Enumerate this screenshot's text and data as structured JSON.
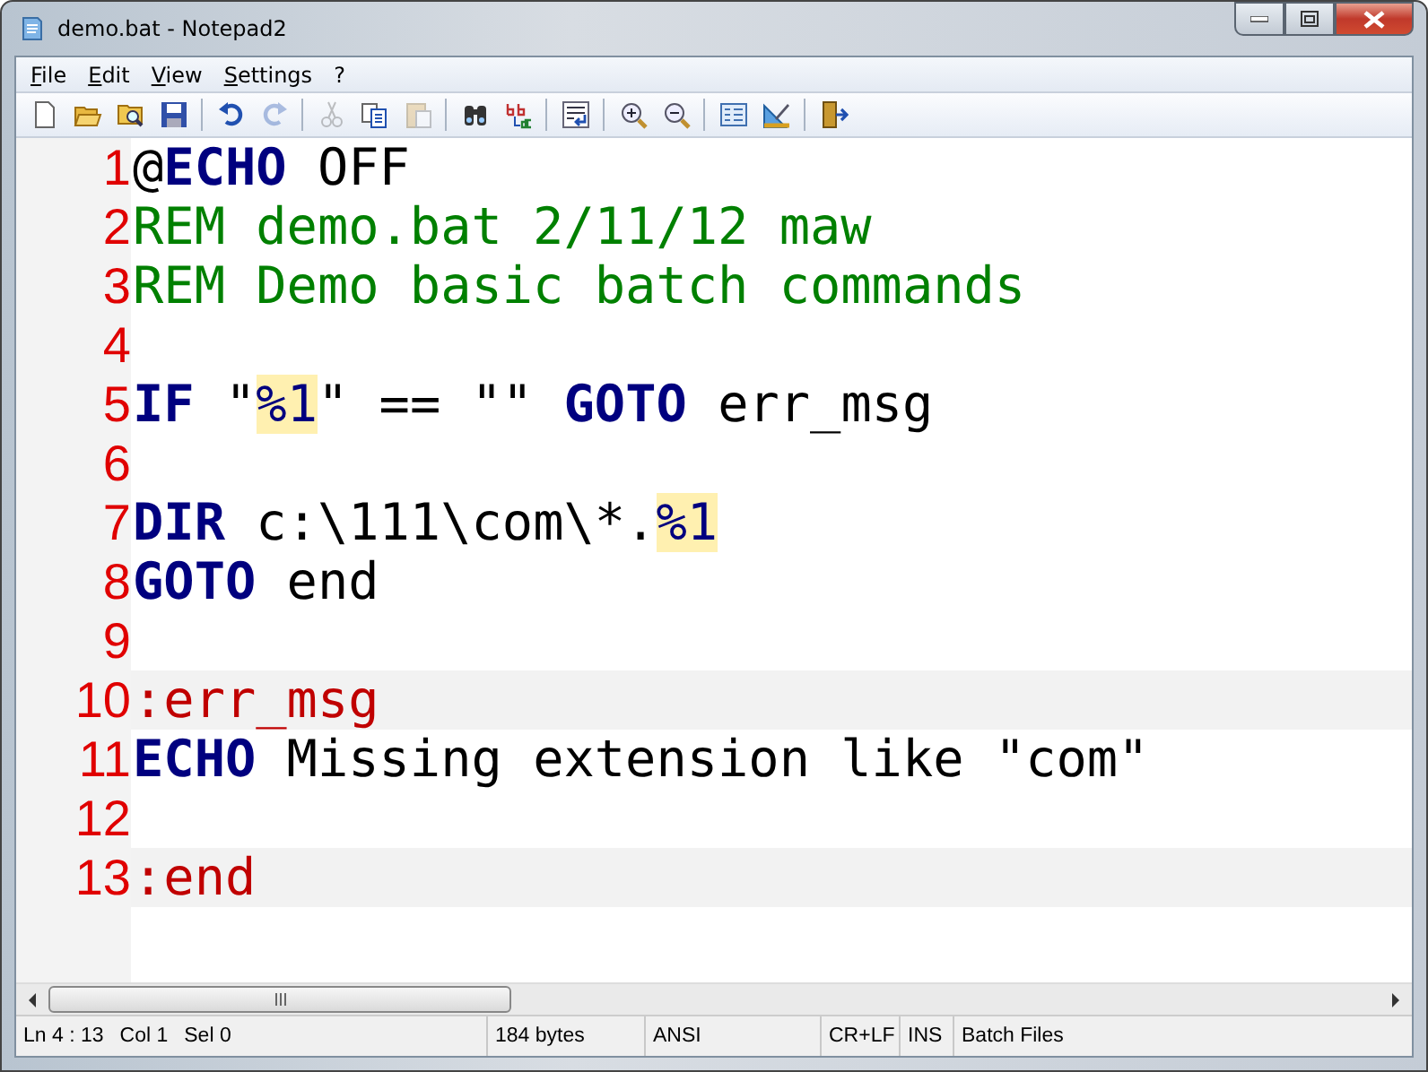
{
  "window": {
    "title": "demo.bat - Notepad2"
  },
  "menu": [
    {
      "label": "File",
      "mnemonic": true
    },
    {
      "label": "Edit",
      "mnemonic": true
    },
    {
      "label": "View",
      "mnemonic": true
    },
    {
      "label": "Settings",
      "mnemonic": true
    },
    {
      "label": "?",
      "mnemonic": false
    }
  ],
  "toolbar": [
    {
      "kind": "new",
      "disabled": false
    },
    {
      "kind": "open",
      "disabled": false
    },
    {
      "kind": "browse",
      "disabled": false
    },
    {
      "kind": "save",
      "disabled": false
    },
    {
      "kind": "separator"
    },
    {
      "kind": "undo",
      "disabled": false
    },
    {
      "kind": "redo",
      "disabled": true
    },
    {
      "kind": "separator"
    },
    {
      "kind": "cut",
      "disabled": true
    },
    {
      "kind": "copy",
      "disabled": false
    },
    {
      "kind": "paste",
      "disabled": true
    },
    {
      "kind": "separator"
    },
    {
      "kind": "find",
      "disabled": false
    },
    {
      "kind": "replace",
      "disabled": false
    },
    {
      "kind": "separator"
    },
    {
      "kind": "wrap",
      "disabled": false
    },
    {
      "kind": "separator"
    },
    {
      "kind": "zoomin",
      "disabled": false
    },
    {
      "kind": "zoomout",
      "disabled": false
    },
    {
      "kind": "separator"
    },
    {
      "kind": "scheme",
      "disabled": false
    },
    {
      "kind": "customize",
      "disabled": false
    },
    {
      "kind": "separator"
    },
    {
      "kind": "exit",
      "disabled": false
    }
  ],
  "editor": {
    "lines": [
      {
        "number": "1",
        "tokens": [
          {
            "kind": "plain",
            "text": "@"
          },
          {
            "kind": "keyword",
            "text": "ECHO"
          },
          {
            "kind": "plain",
            "text": " OFF"
          }
        ]
      },
      {
        "number": "2",
        "tokens": [
          {
            "kind": "comment",
            "text": "REM demo.bat 2/11/12 maw"
          }
        ]
      },
      {
        "number": "3",
        "tokens": [
          {
            "kind": "comment",
            "text": "REM Demo basic batch commands"
          }
        ]
      },
      {
        "number": "4"
      },
      {
        "number": "5",
        "tokens": [
          {
            "kind": "keyword",
            "text": "IF"
          },
          {
            "kind": "plain",
            "text": " \""
          },
          {
            "kind": "variable",
            "text": "%1"
          },
          {
            "kind": "plain",
            "text": "\" == \"\" "
          },
          {
            "kind": "keyword",
            "text": "GOTO"
          },
          {
            "kind": "plain",
            "text": " err_msg"
          }
        ]
      },
      {
        "number": "6"
      },
      {
        "number": "7",
        "tokens": [
          {
            "kind": "keyword",
            "text": "DIR"
          },
          {
            "kind": "plain",
            "text": " c:\\111\\com\\*."
          },
          {
            "kind": "variable",
            "text": "%1"
          }
        ]
      },
      {
        "number": "8",
        "tokens": [
          {
            "kind": "keyword",
            "text": "GOTO"
          },
          {
            "kind": "plain",
            "text": " end"
          }
        ]
      },
      {
        "number": "9"
      },
      {
        "number": "10",
        "tokens": [
          {
            "kind": "label",
            "text": ":err_msg"
          }
        ]
      },
      {
        "number": "11",
        "tokens": [
          {
            "kind": "keyword",
            "text": "ECHO"
          },
          {
            "kind": "plain",
            "text": " Missing extension like \"com\""
          }
        ]
      },
      {
        "number": "12"
      },
      {
        "number": "13",
        "tokens": [
          {
            "kind": "label",
            "text": ":end"
          }
        ]
      }
    ]
  },
  "status_bar": {
    "position": [
      "Ln 4 : 13",
      "Col 1",
      "Sel 0"
    ],
    "segments": [
      "184 bytes",
      "ANSI",
      "CR+LF",
      "INS",
      "Batch Files"
    ]
  }
}
